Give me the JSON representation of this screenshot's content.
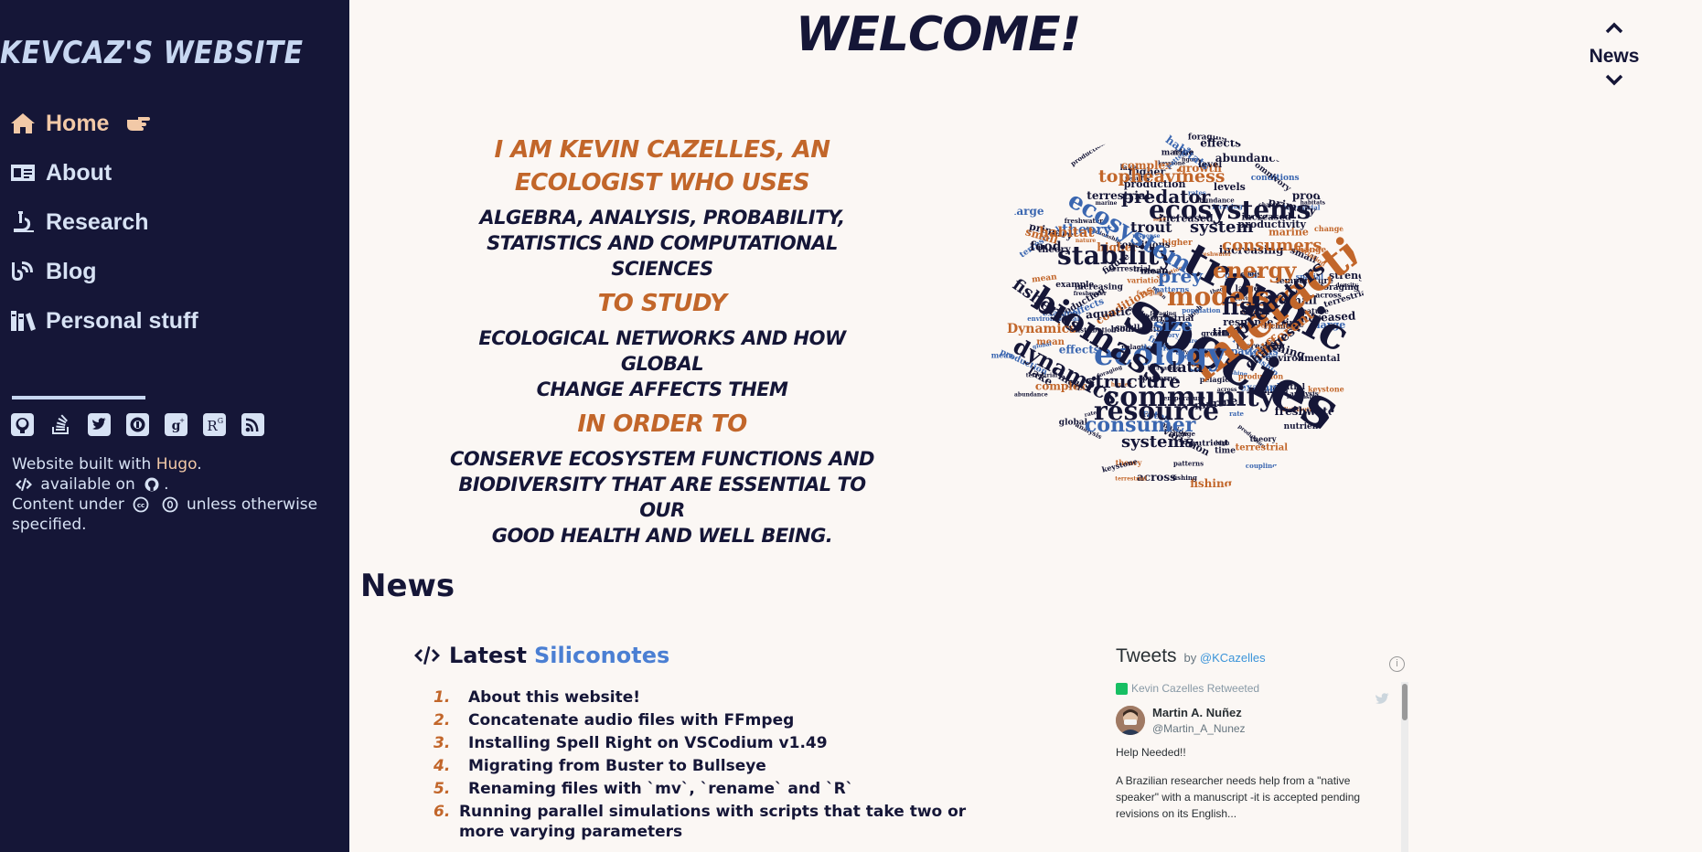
{
  "sidebar": {
    "title": "KEVCAZ'S WEBSITE",
    "nav": [
      {
        "label": "Home",
        "icon": "home-icon"
      },
      {
        "label": "About",
        "icon": "id-card-icon"
      },
      {
        "label": "Research",
        "icon": "microscope-icon"
      },
      {
        "label": "Blog",
        "icon": "blog-icon"
      },
      {
        "label": "Personal stuff",
        "icon": "books-icon"
      }
    ],
    "social_icons": [
      "github-icon",
      "stackoverflow-icon",
      "twitter-icon",
      "orcid-icon",
      "google-scholar-icon",
      "researchgate-icon",
      "rss-icon"
    ],
    "footer": {
      "built_prefix": "Website built with ",
      "built_link": "Hugo",
      "built_suffix": ".",
      "available": "available on",
      "available_suffix": ".",
      "content_prefix": "Content under",
      "content_suffix": "unless otherwise specified."
    },
    "colors": {
      "background": "#151637",
      "active": "#f2c9a7",
      "text": "#d7e2f4"
    }
  },
  "header": {
    "welcome": "WELCOME!",
    "news_nav_label": "News"
  },
  "intro": {
    "line1": "I AM KEVIN CAZELLES, AN",
    "line2": "ECOLOGIST WHO USES",
    "line3": "ALGEBRA, ANALYSIS, PROBABILITY,",
    "line4": "STATISTICS AND COMPUTATIONAL SCIENCES",
    "line5": "TO STUDY",
    "line6": "ECOLOGICAL NETWORKS AND HOW GLOBAL",
    "line7": "CHANGE AFFECTS THEM",
    "line8": "IN ORDER TO",
    "line9": "CONSERVE ECOSYSTEM FUNCTIONS AND",
    "line10": "BIODIVERSITY THAT ARE ESSENTIAL TO OUR",
    "line11": "GOOD HEALTH AND WELL BEING."
  },
  "wordcloud": {
    "words": [
      "species",
      "trophic",
      "interaction",
      "ecology",
      "biomass",
      "community",
      "stability",
      "ecosystems",
      "ecosystem",
      "models",
      "energy",
      "fish",
      "consumer",
      "consumers",
      "resource",
      "structure",
      "predator",
      "predators",
      "dynamics",
      "food",
      "prey",
      "size",
      "topheaviness",
      "theory",
      "systems",
      "system",
      "data",
      "Dynamics",
      "fisheries",
      "habitat",
      "trout",
      "different",
      "changes",
      "change",
      "population",
      "aquatic",
      "results",
      "nature",
      "production",
      "environmental",
      "patterns",
      "increasing",
      "temperature",
      "growth",
      "across",
      "rates",
      "higher",
      "density",
      "level",
      "levels",
      "rate",
      "spatial",
      "theory",
      "diversity",
      "productivity",
      "omnivory",
      "large",
      "coupling",
      "habitats",
      "fishing",
      "freshwater",
      "marine",
      "pelagic",
      "effects",
      "abundance",
      "richness",
      "keystone",
      "foraging",
      "variation",
      "complex",
      "nutrient",
      "figure",
      "primary",
      "response",
      "analysis",
      "terrestrial",
      "distribution",
      "conditions",
      "increased",
      "example",
      "relationship",
      "strength",
      "mean",
      "global",
      "time",
      "high",
      "lake",
      "small",
      "biodiversity"
    ],
    "colors": {
      "dark": "#151637",
      "orange": "#c2662a",
      "blue": "#3a66b0"
    }
  },
  "news": {
    "title": "News",
    "latest_label": "Latest",
    "latest_link": "Siliconotes",
    "posts": [
      {
        "num": "1.",
        "title": "About this website!"
      },
      {
        "num": "2.",
        "title": "Concatenate audio files with FFmpeg"
      },
      {
        "num": "3.",
        "title": "Installing Spell Right on VSCodium v1.49"
      },
      {
        "num": "4.",
        "title": "Migrating from Buster to Bullseye"
      },
      {
        "num": "5.",
        "title": "Renaming files with `mv`, `rename` and `R`"
      },
      {
        "num": "6.",
        "title": "Running parallel simulations with scripts that take two or more varying parameters"
      }
    ]
  },
  "tweets": {
    "title": "Tweets",
    "by": "by",
    "handle": "@KCazelles",
    "info": "i",
    "retweeted": "Kevin Cazelles Retweeted",
    "author_name": "Martin A. Nuñez",
    "author_handle": "@Martin_A_Nunez",
    "text1": "Help Needed!!",
    "text2": "A Brazilian researcher needs help from a \"native speaker\" with a manuscript -it is accepted pending revisions on its English..."
  },
  "colors": {
    "page_bg": "#fbf7f4",
    "accent_orange": "#c2662a",
    "link_blue": "#4b7fd3"
  }
}
